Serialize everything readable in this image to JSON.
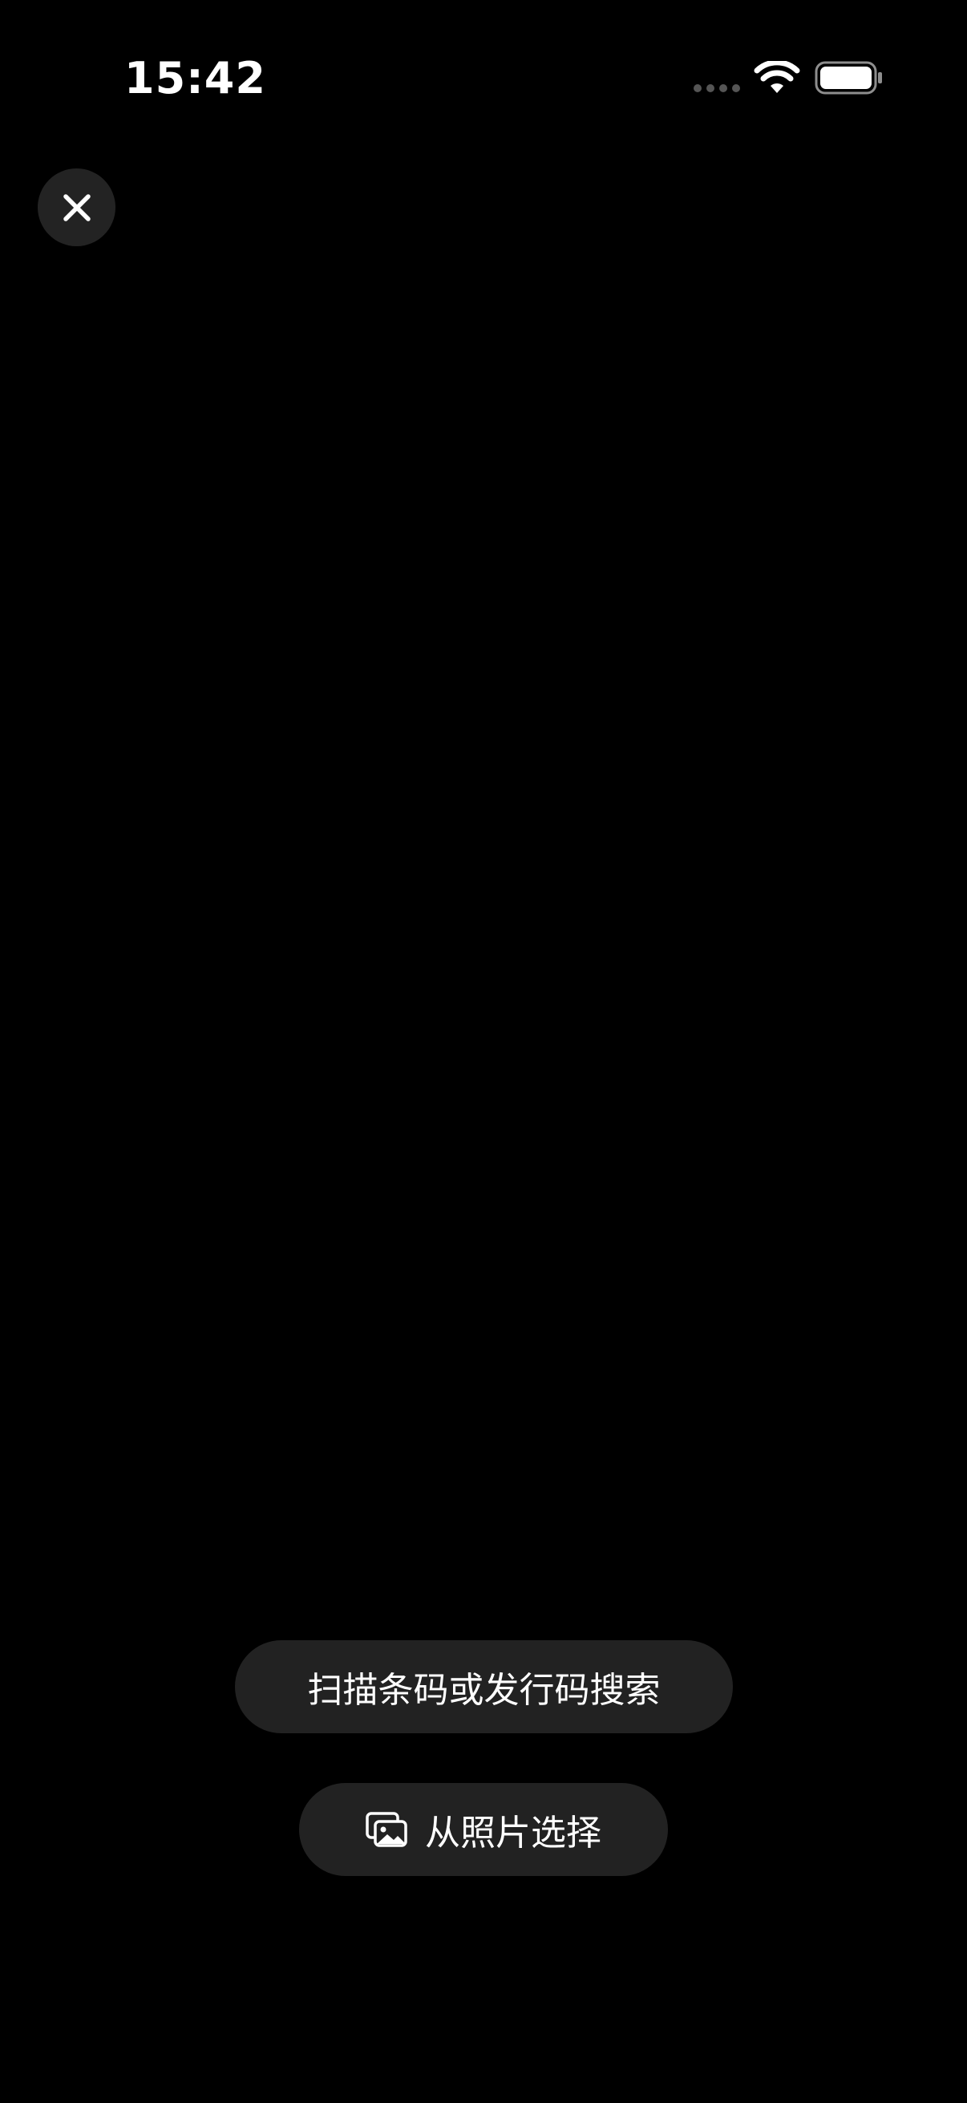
{
  "status_bar": {
    "time": "15:42"
  },
  "icons": {
    "close": "close-icon",
    "photos": "photo-library-icon",
    "wifi": "wifi-icon",
    "battery": "battery-icon"
  },
  "scan": {
    "label": "扫描条码或发行码搜索"
  },
  "photo_picker": {
    "label": "从照片选择"
  },
  "colors": {
    "background": "#000000",
    "pill": "#222222",
    "close_bg": "#232323",
    "text": "#ffffff"
  }
}
